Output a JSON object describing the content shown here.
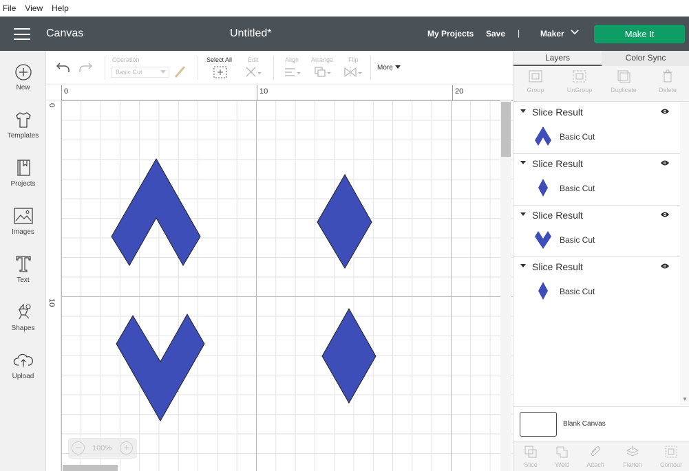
{
  "menu": {
    "file": "File",
    "view": "View",
    "help": "Help"
  },
  "header": {
    "app_name": "Canvas",
    "doc_title": "Untitled*",
    "my_projects": "My Projects",
    "save": "Save",
    "separator": "|",
    "machine": "Maker",
    "make_it": "Make It",
    "make_it_color": "#0f9d66",
    "bg_color": "#4a5258"
  },
  "sidebar": {
    "items": [
      {
        "label": "New",
        "icon": "plus-circle-icon"
      },
      {
        "label": "Templates",
        "icon": "tshirt-icon"
      },
      {
        "label": "Projects",
        "icon": "book-icon"
      },
      {
        "label": "Images",
        "icon": "image-icon"
      },
      {
        "label": "Text",
        "icon": "text-t-icon"
      },
      {
        "label": "Shapes",
        "icon": "shapes-icon"
      },
      {
        "label": "Upload",
        "icon": "cloud-upload-icon"
      }
    ]
  },
  "toolbar": {
    "operation_label": "Operation",
    "operation_value": "Basic Cut",
    "select_all": "Select All",
    "edit": "Edit",
    "align": "Align",
    "arrange": "Arrange",
    "flip": "Flip",
    "more": "More"
  },
  "rulers": {
    "top": [
      "0",
      "10",
      "20"
    ],
    "left": [
      "0",
      "10"
    ]
  },
  "zoom": {
    "value": "100%",
    "minus": "−",
    "plus": "+"
  },
  "panel": {
    "tabs": [
      "Layers",
      "Color Sync"
    ],
    "actions": [
      "Group",
      "UnGroup",
      "Duplicate",
      "Delete"
    ],
    "groups": [
      {
        "name": "Slice Result",
        "layer": "Basic Cut",
        "shape": "chevron-up"
      },
      {
        "name": "Slice Result",
        "layer": "Basic Cut",
        "shape": "diamond"
      },
      {
        "name": "Slice Result",
        "layer": "Basic Cut",
        "shape": "chevron-down"
      },
      {
        "name": "Slice Result",
        "layer": "Basic Cut",
        "shape": "diamond"
      }
    ],
    "blank_canvas": "Blank Canvas",
    "bottom_actions": [
      "Slice",
      "Weld",
      "Attach",
      "Flatten",
      "Contour"
    ]
  },
  "colors": {
    "shape_fill": "#3d4eb8",
    "shape_stroke": "#222222"
  }
}
